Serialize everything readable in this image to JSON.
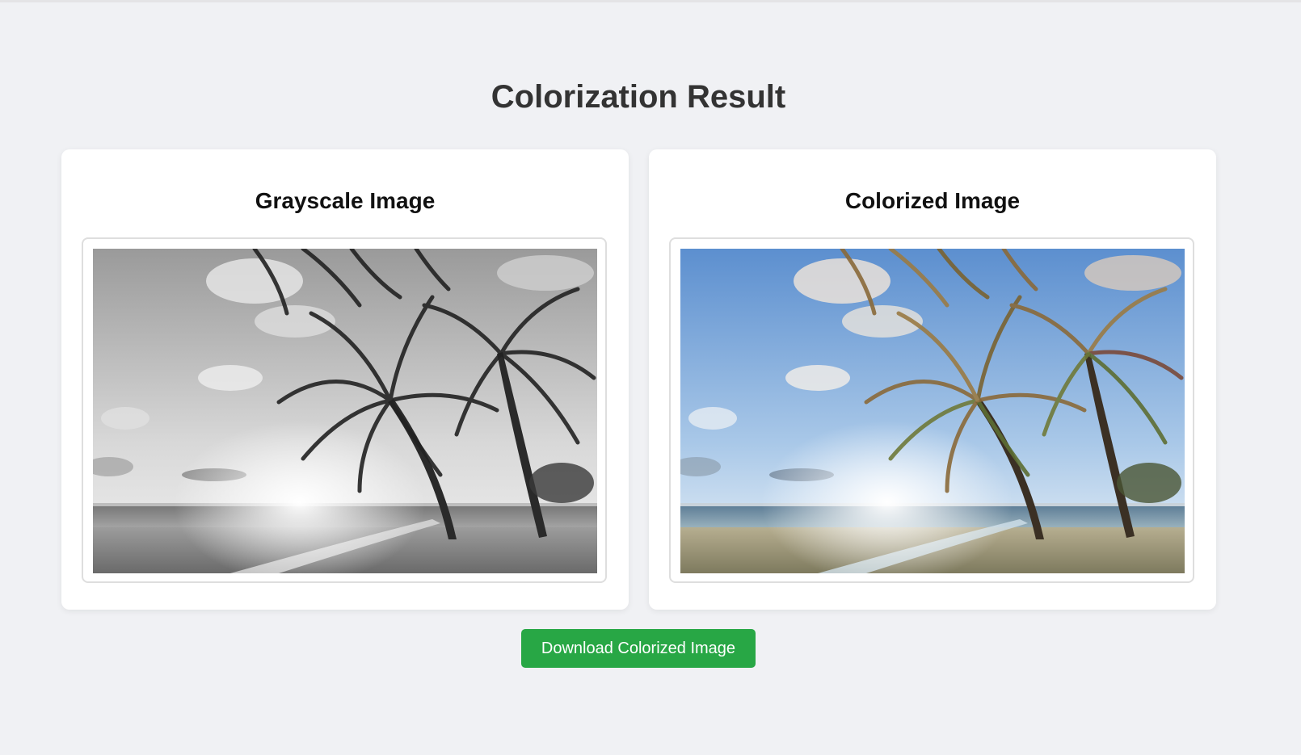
{
  "page": {
    "title": "Colorization Result"
  },
  "cards": {
    "grayscale": {
      "title": "Grayscale Image",
      "image_subject": "beach-palm-trees-grayscale"
    },
    "colorized": {
      "title": "Colorized Image",
      "image_subject": "beach-palm-trees-colorized"
    }
  },
  "actions": {
    "download_label": "Download Colorized Image"
  },
  "colors": {
    "background": "#f0f1f4",
    "card": "#ffffff",
    "button": "#28a745",
    "button_text": "#ffffff",
    "title_text": "#333333"
  }
}
